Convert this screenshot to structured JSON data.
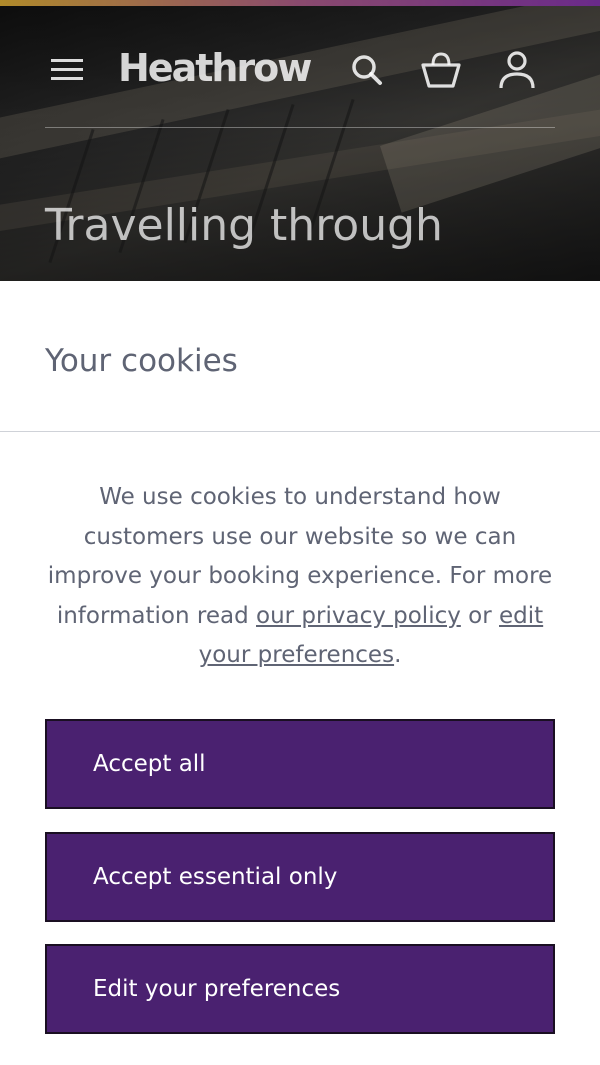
{
  "header": {
    "brand": "Heathrow",
    "menu_icon": "hamburger-menu-icon",
    "search_icon": "search-icon",
    "basket_icon": "basket-icon",
    "account_icon": "account-icon"
  },
  "hero": {
    "title": "Travelling through"
  },
  "cookies": {
    "title": "Your cookies",
    "body_before_link": "We use cookies to understand how customers use our website so we can improve your booking experience. For more information read ",
    "privacy_link": "our privacy policy",
    "body_between": " or ",
    "preferences_link": "edit your preferences",
    "body_end": ".",
    "buttons": {
      "accept_all": "Accept all",
      "accept_essential": "Accept essential only",
      "edit_preferences": "Edit your preferences"
    }
  },
  "colors": {
    "button_purple": "#4a2170",
    "text_grey": "#5f6474",
    "divider": "#cfd2d8"
  }
}
